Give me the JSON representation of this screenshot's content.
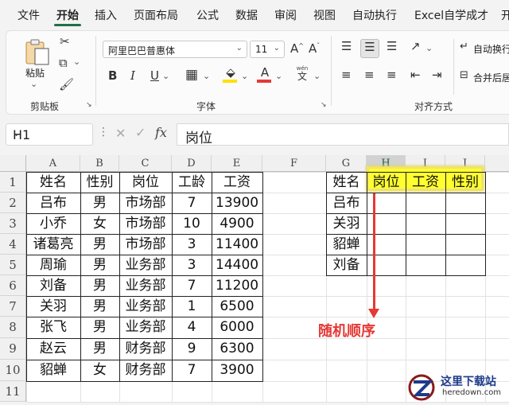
{
  "menu": {
    "tabs": [
      "文件",
      "开始",
      "插入",
      "页面布局",
      "公式",
      "数据",
      "审阅",
      "视图",
      "自动执行",
      "Excel自学成才",
      "开"
    ],
    "active": "开始"
  },
  "ribbon": {
    "paste_label": "粘贴",
    "clipboard_group": "剪贴板",
    "font_group": "字体",
    "align_group": "对齐方式",
    "font_name": "阿里巴巴普惠体",
    "font_size": "11",
    "bold": "B",
    "italic": "I",
    "underline": "U",
    "font_color_glyph": "A",
    "wen_glyph_top": "wén",
    "wen_glyph": "文",
    "grow_font": "A",
    "shrink_font": "A",
    "wrap_text": "自动换行",
    "merge_center": "合并后居",
    "colors": {
      "highlight": "#ffe000",
      "font_color": "#e53935"
    }
  },
  "formula_bar": {
    "name_box": "H1",
    "fx_label": "fx",
    "content": "岗位"
  },
  "sheet": {
    "columns": [
      "A",
      "B",
      "C",
      "D",
      "E",
      "F",
      "G",
      "H",
      "I",
      "J"
    ],
    "rows": [
      "1",
      "2",
      "3",
      "4",
      "5",
      "6",
      "7",
      "8",
      "9",
      "10",
      "11"
    ],
    "selected_cell": "H1",
    "main_table": {
      "header": [
        "姓名",
        "性别",
        "岗位",
        "工龄",
        "工资"
      ],
      "rows": [
        [
          "吕布",
          "男",
          "市场部",
          "7",
          "13900"
        ],
        [
          "小乔",
          "女",
          "市场部",
          "10",
          "4900"
        ],
        [
          "诸葛亮",
          "男",
          "市场部",
          "3",
          "11400"
        ],
        [
          "周瑜",
          "男",
          "业务部",
          "3",
          "14400"
        ],
        [
          "刘备",
          "男",
          "业务部",
          "7",
          "11200"
        ],
        [
          "关羽",
          "男",
          "业务部",
          "1",
          "6500"
        ],
        [
          "张飞",
          "男",
          "业务部",
          "4",
          "6000"
        ],
        [
          "赵云",
          "男",
          "财务部",
          "9",
          "6300"
        ],
        [
          "貂蝉",
          "女",
          "财务部",
          "7",
          "3900"
        ]
      ]
    },
    "lookup_table": {
      "header": [
        "姓名",
        "岗位",
        "工资",
        "性别"
      ],
      "names": [
        "吕布",
        "关羽",
        "貂蝉",
        "刘备"
      ]
    }
  },
  "annotation": {
    "text": "随机顺序",
    "color": "#e53935"
  },
  "watermark": {
    "title": "这里下载站",
    "url": "heredown.com"
  }
}
